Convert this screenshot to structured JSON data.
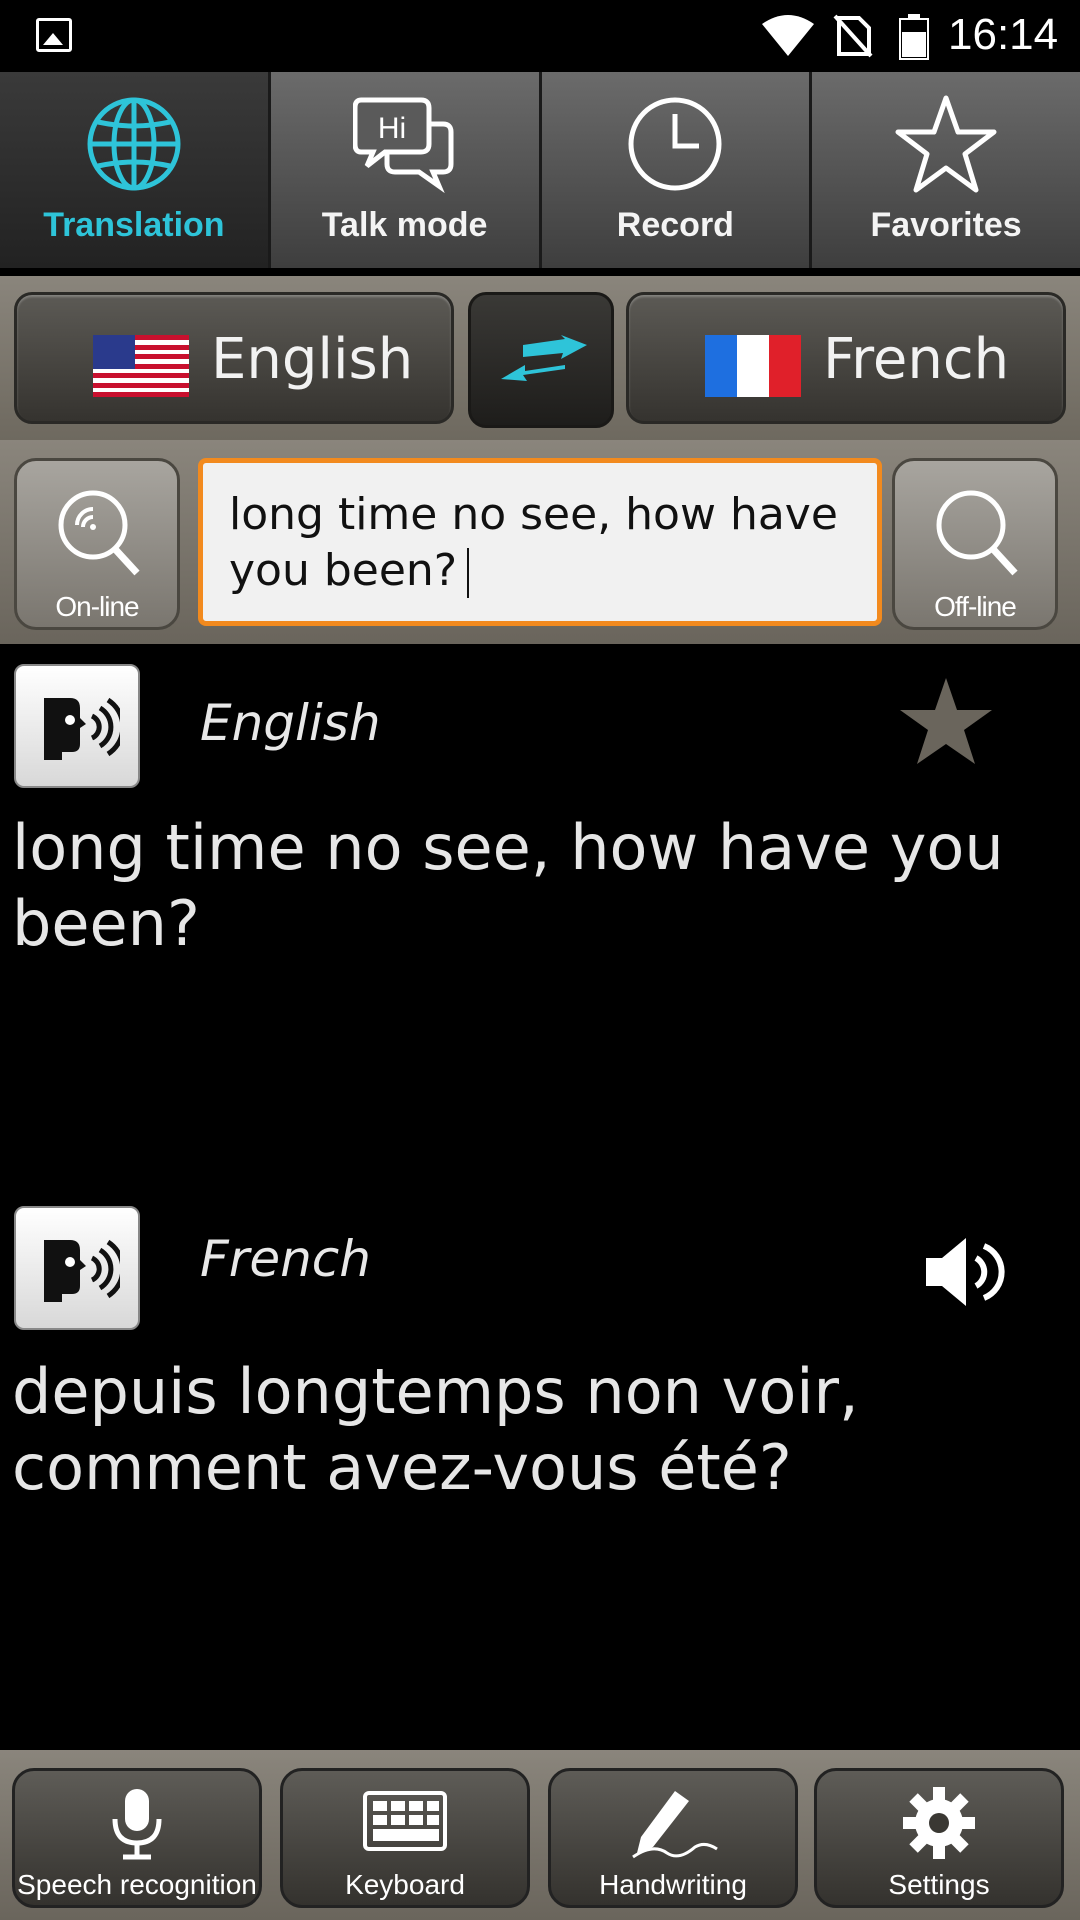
{
  "status": {
    "time": "16:14"
  },
  "tabs": [
    {
      "label": "Translation",
      "icon": "globe-icon",
      "active": true
    },
    {
      "label": "Talk mode",
      "icon": "chat-bubbles-icon",
      "active": false
    },
    {
      "label": "Record",
      "icon": "clock-icon",
      "active": false
    },
    {
      "label": "Favorites",
      "icon": "star-icon",
      "active": false
    }
  ],
  "languages": {
    "source": "English",
    "target": "French"
  },
  "search": {
    "online_label": "On-line",
    "offline_label": "Off-line",
    "input_value": "long time no see, how have you been?"
  },
  "results": {
    "source_lang": "English",
    "source_text": "long time no see, how have you been?",
    "target_lang": "French",
    "target_text": "depuis longtemps non voir, comment avez-vous été?"
  },
  "toolbar": [
    {
      "label": "Speech recognition",
      "icon": "microphone-icon"
    },
    {
      "label": "Keyboard",
      "icon": "keyboard-icon"
    },
    {
      "label": "Handwriting",
      "icon": "pen-icon"
    },
    {
      "label": "Settings",
      "icon": "gear-icon"
    }
  ],
  "colors": {
    "accent": "#2ec4d9",
    "input_border": "#f28a1e"
  }
}
